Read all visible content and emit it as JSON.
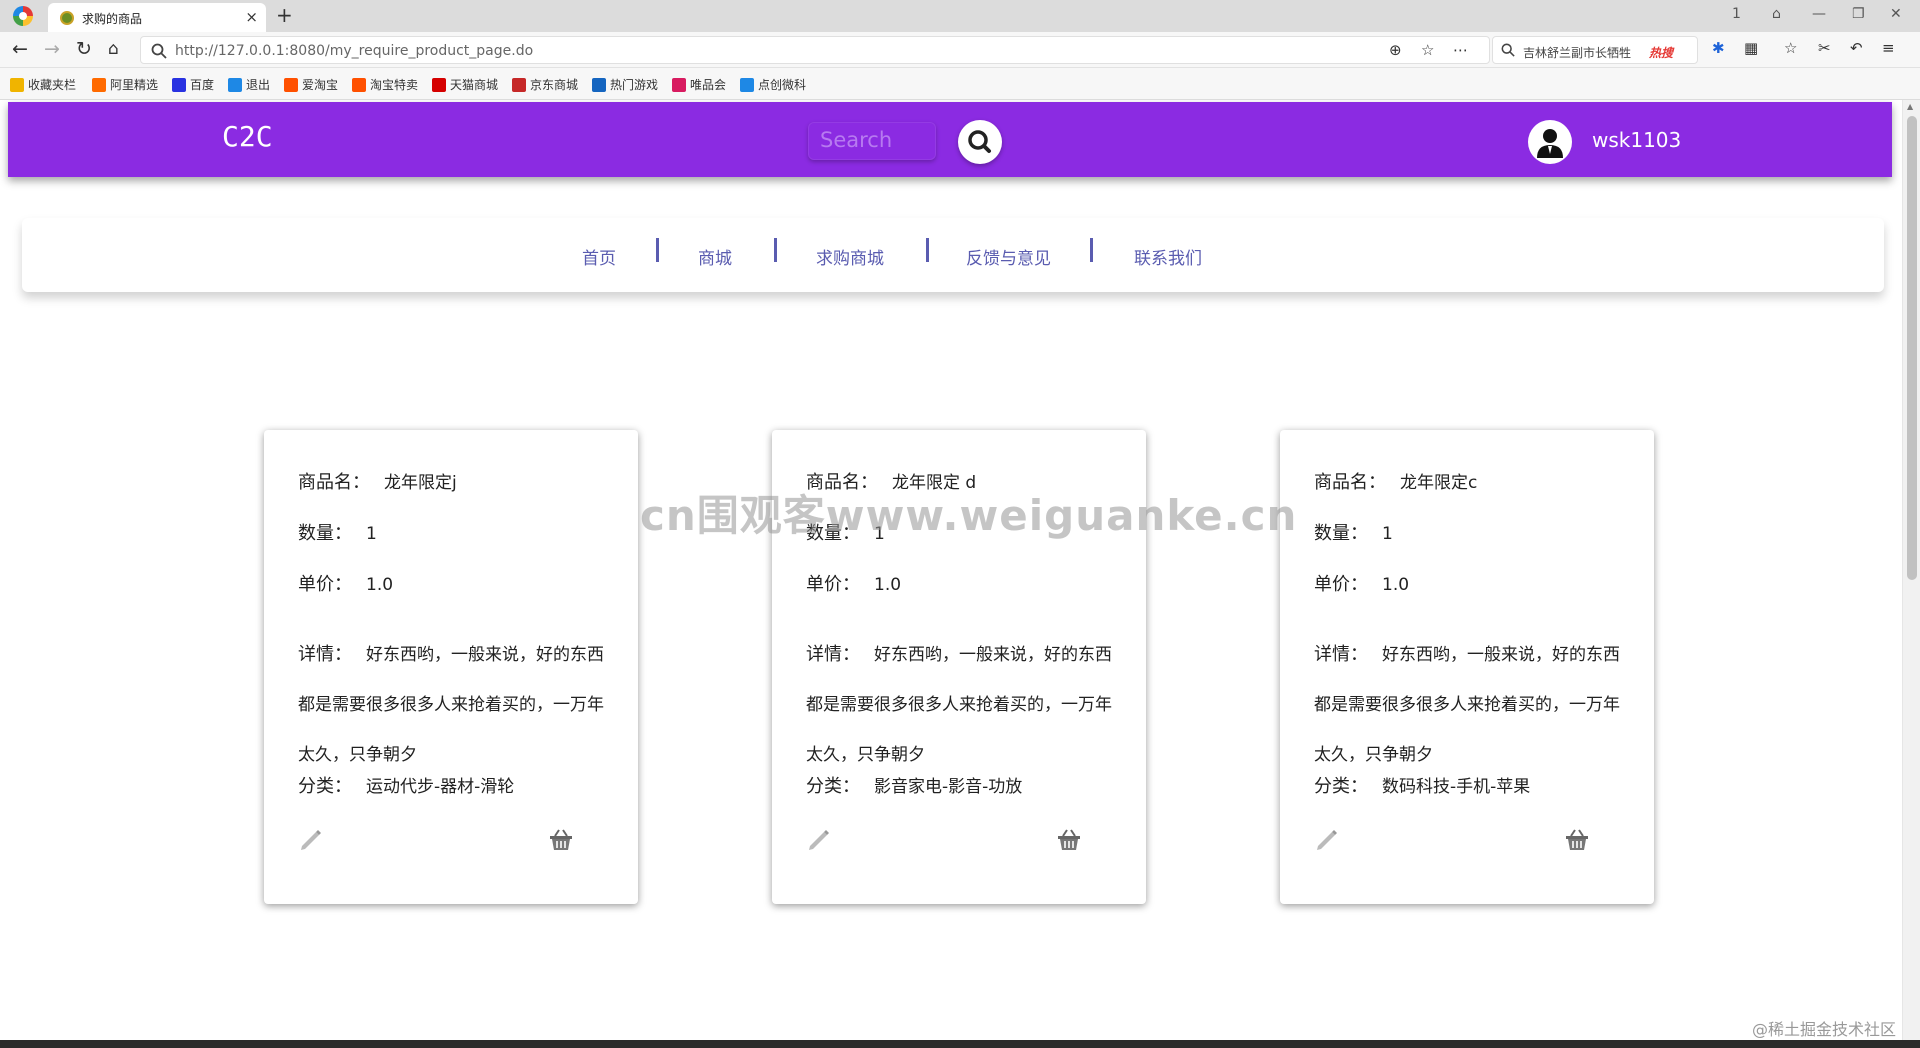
{
  "browser": {
    "tab_title": "求购的商品",
    "tab_close": "×",
    "new_tab": "+",
    "url": "http://127.0.0.1:8080/my_require_product_page.do",
    "search_text": "吉林舒兰副市长牺牲",
    "search_hot": "热搜",
    "window_controls": [
      "1",
      "⌂",
      "—",
      "❐",
      "✕"
    ]
  },
  "bookmarks": [
    {
      "label": "收藏夹栏",
      "color": "#f0b400"
    },
    {
      "label": "阿里精选",
      "color": "#ff6a00"
    },
    {
      "label": "百度",
      "color": "#2932e1"
    },
    {
      "label": "退出",
      "color": "#1e88e5"
    },
    {
      "label": "爱淘宝",
      "color": "#ff5000"
    },
    {
      "label": "淘宝特卖",
      "color": "#ff5000"
    },
    {
      "label": "天猫商城",
      "color": "#d50000"
    },
    {
      "label": "京东商城",
      "color": "#c62828"
    },
    {
      "label": "热门游戏",
      "color": "#1565c0"
    },
    {
      "label": "唯品会",
      "color": "#d81b60"
    },
    {
      "label": "点创微科",
      "color": "#1e88e5"
    }
  ],
  "header": {
    "brand": "C2C",
    "search_placeholder": "Search",
    "username": "wsk1103",
    "color": "#8b2be2"
  },
  "menu": [
    "首页",
    "商城",
    "求购商城",
    "反馈与意见",
    "联系我们"
  ],
  "labels": {
    "name": "商品名：",
    "quantity": "数量：",
    "price": "单价：",
    "detail": "详情：",
    "category": "分类："
  },
  "products": [
    {
      "name": "龙年限定j",
      "quantity": "1",
      "price": "1.0",
      "detail": "好东西哟，一般来说，好的东西都是需要很多很多人来抢着买的，一万年太久，只争朝夕",
      "category": "运动代步-器材-滑轮"
    },
    {
      "name": "龙年限定 d",
      "quantity": "1",
      "price": "1.0",
      "detail": "好东西哟，一般来说，好的东西都是需要很多很多人来抢着买的，一万年太久，只争朝夕",
      "category": "影音家电-影音-功放"
    },
    {
      "name": "龙年限定c",
      "quantity": "1",
      "price": "1.0",
      "detail": "好东西哟，一般来说，好的东西都是需要很多很多人来抢着买的，一万年太久，只争朝夕",
      "category": "数码科技-手机-苹果"
    }
  ],
  "watermark": "cn围观客www.weiguanke.cn",
  "corner_mark": "@稀土掘金技术社区"
}
